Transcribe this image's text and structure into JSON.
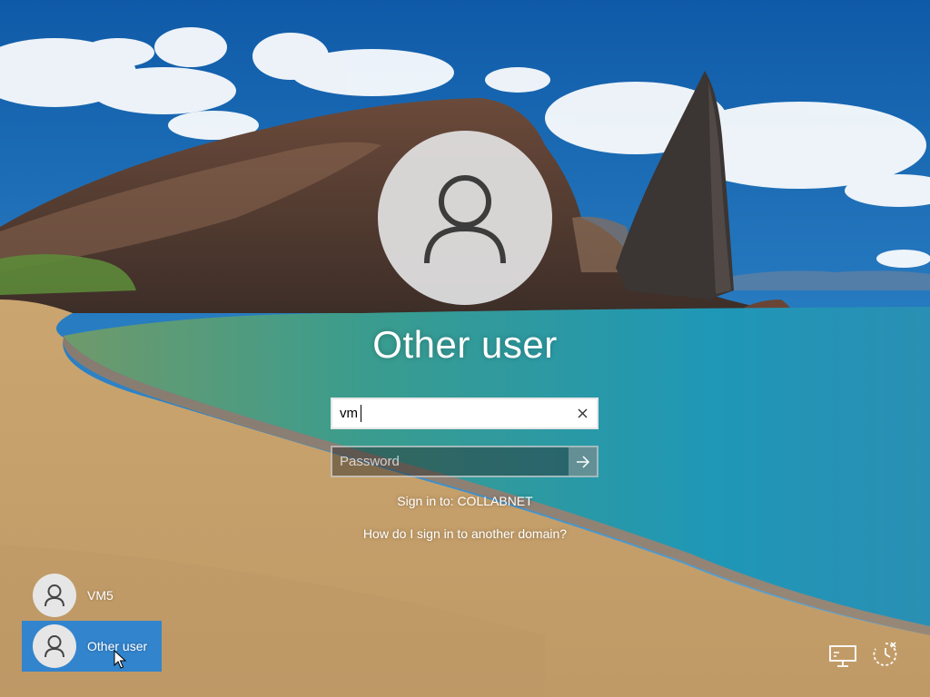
{
  "selected_user": {
    "name": "Other user"
  },
  "sign_in_form": {
    "username_value": "vm",
    "password_placeholder": "Password",
    "sign_in_to": "Sign in to: COLLABNET",
    "domain_help_link": "How do I sign in to another domain?"
  },
  "user_list": [
    {
      "name": "VM5",
      "selected": false
    },
    {
      "name": "Other user",
      "selected": true
    }
  ],
  "icons": {
    "large_avatar": "user-icon",
    "clear": "close-icon",
    "submit": "arrow-right-icon",
    "network": "network-icon",
    "power": "ease-of-access-icon"
  },
  "colors": {
    "selected_tile": "#2682d6",
    "avatar_bg": "#e1e1e1"
  }
}
